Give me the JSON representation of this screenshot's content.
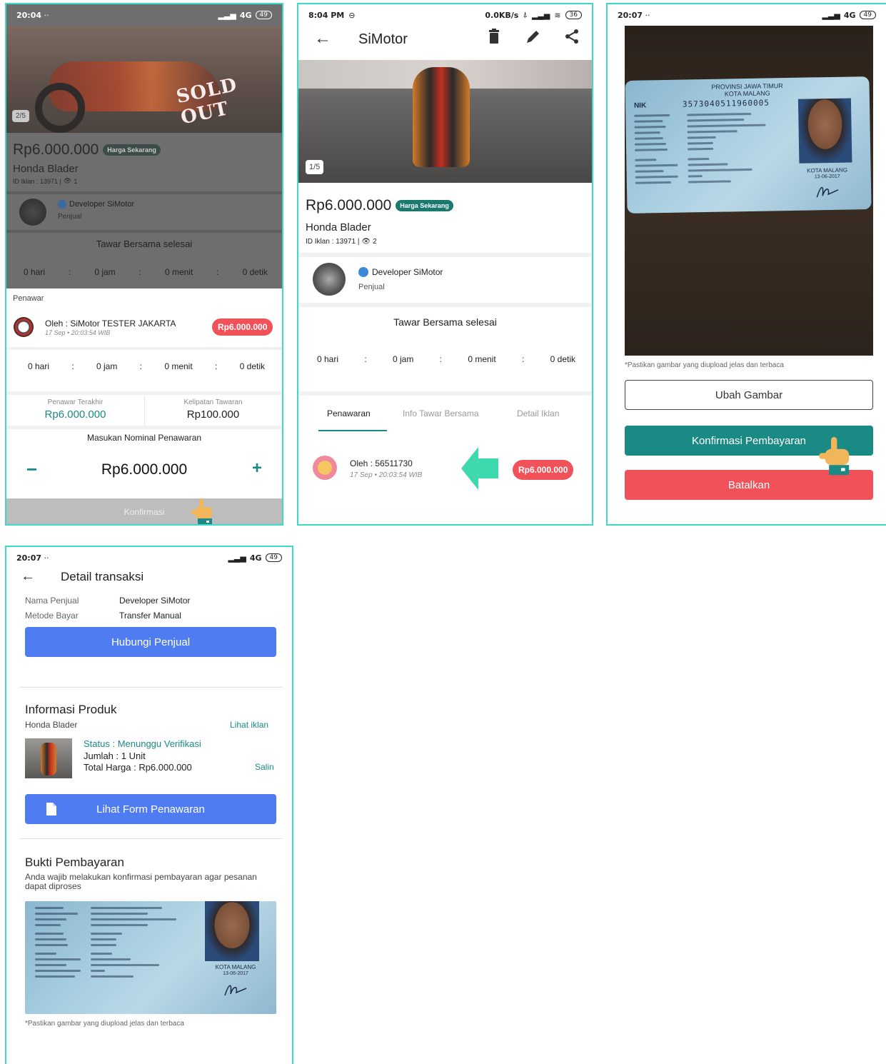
{
  "screen1": {
    "time": "20:04",
    "dots": "··",
    "network": "4G",
    "battery": "49",
    "image_counter": "2/5",
    "sold_out": "SOLD OUT",
    "price": "Rp6.000.000",
    "price_badge": "Harga Sekarang",
    "title": "Honda Blader",
    "ad_id": "ID Iklan : 13971 | ",
    "views": "1",
    "seller_name": "Developer SiMotor",
    "seller_role": "Penjual",
    "auction_status": "Tawar Bersama selesai",
    "countdown_top": [
      "0 hari",
      "0 jam",
      "0 menit",
      "0 detik"
    ],
    "bidder_section": "Penawar",
    "bidder_name": "Oleh : SiMotor TESTER JAKARTA",
    "bidder_time": "17 Sep • 20:03:54 WIB",
    "bidder_amount": "Rp6.000.000",
    "countdown": [
      "0 hari",
      "0 jam",
      "0 menit",
      "0 detik"
    ],
    "last_bid_label": "Penawar Terakhir",
    "last_bid_value": "Rp6.000.000",
    "multiple_label": "Kelipatan Tawaran",
    "multiple_value": "Rp100.000",
    "nominal_label": "Masukan Nominal Penawaran",
    "nominal_value": "Rp6.000.000",
    "minus": "−",
    "plus": "+",
    "confirm": "Konfirmasi"
  },
  "screen2": {
    "time": "8:04 PM",
    "speed": "0.0KB/s",
    "battery": "36",
    "app_title": "SiMotor",
    "image_counter": "1/5",
    "price": "Rp6.000.000",
    "price_badge": "Harga Sekarang",
    "title": "Honda Blader",
    "ad_id": "ID Iklan : 13971 | ",
    "views": "2",
    "seller_name": "Developer SiMotor",
    "seller_role": "Penjual",
    "auction_status": "Tawar Bersama selesai",
    "countdown": [
      "0 hari",
      "0 jam",
      "0 menit",
      "0 detik"
    ],
    "tabs": [
      "Penawaran",
      "Info Tawar Bersama",
      "Detail Iklan"
    ],
    "bidder_name": "Oleh : 56511730",
    "bidder_time": "17 Sep • 20:03:54 WIB",
    "bidder_amount": "Rp6.000.000"
  },
  "screen3": {
    "time": "20:07",
    "dots": "··",
    "network": "4G",
    "battery": "49",
    "id_province": "PROVINSI JAWA TIMUR",
    "id_city": "KOTA MALANG",
    "id_nik_label": "NIK",
    "id_nik": "3573040511960005",
    "id_issue_city": "KOTA MALANG",
    "id_issue_date": "13-06-2017",
    "hint": "*Pastikan gambar yang diupload jelas dan terbaca",
    "change_image": "Ubah Gambar",
    "confirm_payment": "Konfirmasi Pembayaran",
    "cancel": "Batalkan"
  },
  "screen4": {
    "time": "20:07",
    "dots": "··",
    "network": "4G",
    "battery": "49",
    "title": "Detail transaksi",
    "seller_label": "Nama Penjual",
    "seller_value": "Developer SiMotor",
    "method_label": "Metode Bayar",
    "method_value": "Transfer Manual",
    "contact_button": "Hubungi Penjual",
    "product_heading": "Informasi Produk",
    "product_name": "Honda Blader",
    "view_ad": "Lihat iklan",
    "status": "Status : Menunggu Verifikasi",
    "quantity": "Jumlah : 1 Unit",
    "total": "Total Harga : Rp6.000.000",
    "copy": "Salin",
    "offer_form_button": "Lihat Form Penawaran",
    "proof_heading": "Bukti Pembayaran",
    "proof_desc": "Anda wajib melakukan konfirmasi pembayaran agar pesanan dapat diproses",
    "id_issue_city": "KOTA MALANG",
    "id_issue_date": "13-06-2017",
    "hint": "*Pastikan gambar yang diupload jelas dan terbaca"
  },
  "colors": {
    "panel_border": "#3fd9c8",
    "teal": "#1a8a85",
    "red": "#f1525a",
    "blue": "#4f7cf0",
    "overlay": "#6b6b6b"
  }
}
